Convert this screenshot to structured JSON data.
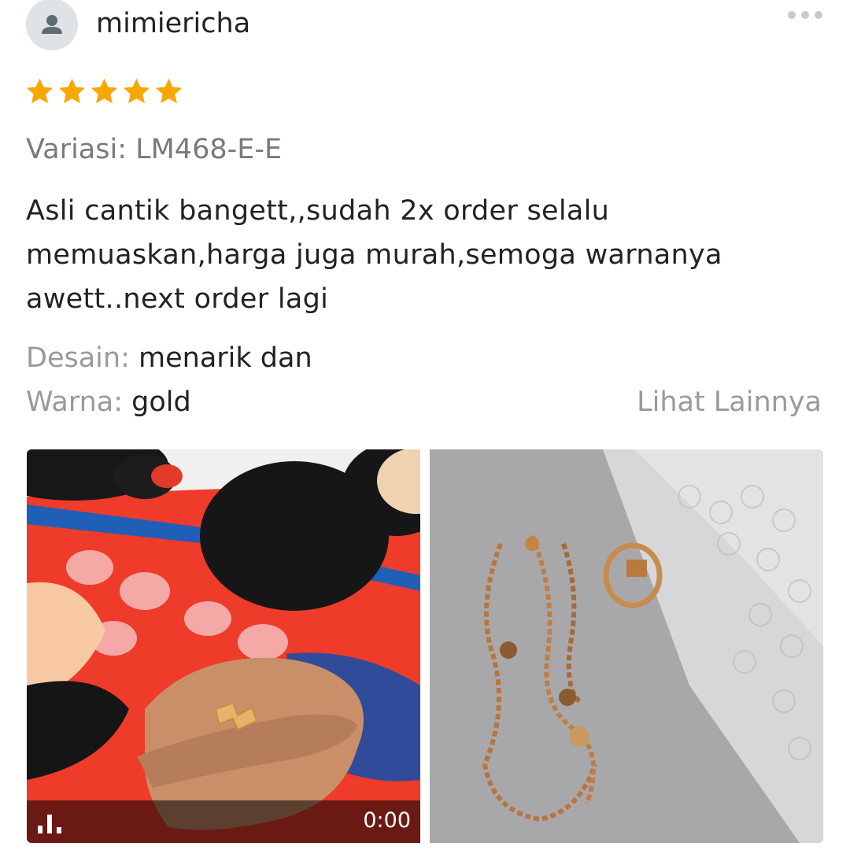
{
  "user": {
    "name": "mimiericha",
    "avatar_icon": "user-silhouette-icon"
  },
  "menu": {
    "icon": "more-dots-icon"
  },
  "rating": {
    "stars": 5,
    "max": 5,
    "color": "#f6a700"
  },
  "variation": {
    "text": "Variasi: LM468-E-E"
  },
  "comment": {
    "text": "Asli cantik bangett,,sudah 2x order selalu memuaskan,harga juga murah,semoga warnanya awett..next order lagi"
  },
  "attributes": [
    {
      "label": "Desain:",
      "value": "menarik dan"
    },
    {
      "label": "Warna:",
      "value": "gold"
    }
  ],
  "see_more": {
    "label": "Lihat Lainnya"
  },
  "media": {
    "video": {
      "duration": "0:00",
      "icon": "video-signal-icon"
    },
    "photo": {
      "subject": "gold-necklace-and-ring"
    }
  }
}
